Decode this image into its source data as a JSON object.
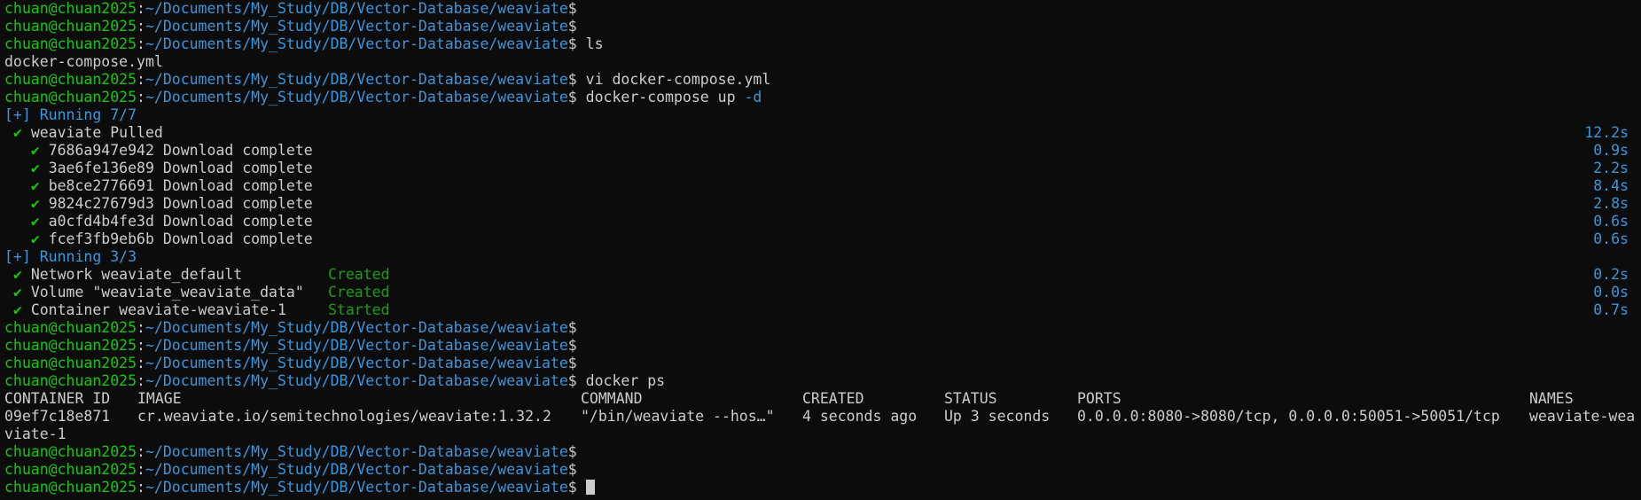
{
  "prompt": {
    "user": "chuan@chuan2025",
    "colon": ":",
    "path": "~/Documents/My_Study/DB/Vector-Database/weaviate",
    "dollar": "$"
  },
  "commands": {
    "ls": "ls",
    "ls_output": "docker-compose.yml",
    "vi": "vi docker-compose.yml",
    "compose_cmd": "docker-compose up ",
    "compose_flag": "-d",
    "ps": "docker ps"
  },
  "pull": {
    "header": "[+] Running 7/7",
    "check_glyph": "✔",
    "main": {
      "label": "weaviate Pulled",
      "time": "12.2s"
    },
    "layers": [
      {
        "id": "7686a947e942",
        "status": "Download complete",
        "time": "0.9s"
      },
      {
        "id": "3ae6fe136e89",
        "status": "Download complete",
        "time": "2.2s"
      },
      {
        "id": "be8ce2776691",
        "status": "Download complete",
        "time": "8.4s"
      },
      {
        "id": "9824c27679d3",
        "status": "Download complete",
        "time": "2.8s"
      },
      {
        "id": "a0cfd4b4fe3d",
        "status": "Download complete",
        "time": "0.6s"
      },
      {
        "id": "fcef3fb9eb6b",
        "status": "Download complete",
        "time": "0.6s"
      }
    ]
  },
  "run": {
    "header": "[+] Running 3/3",
    "items": [
      {
        "label": "Network weaviate_default",
        "state": "Created",
        "time": "0.2s"
      },
      {
        "label": "Volume \"weaviate_weaviate_data\"",
        "state": "Created",
        "time": "0.0s"
      },
      {
        "label": "Container weaviate-weaviate-1",
        "state": "Started",
        "time": "0.7s"
      }
    ]
  },
  "ps_table": {
    "headers": {
      "container_id": "CONTAINER ID",
      "image": "IMAGE",
      "command": "COMMAND",
      "created": "CREATED",
      "status": "STATUS",
      "ports": "PORTS",
      "names": "NAMES"
    },
    "row": {
      "container_id": "09ef7c18e871",
      "image": "cr.weaviate.io/semitechnologies/weaviate:1.32.2",
      "command": "\"/bin/weaviate --hos…\"",
      "created": "4 seconds ago",
      "status": "Up 3 seconds",
      "ports": "0.0.0.0:8080->8080/tcp, 0.0.0.0:50051->50051/tcp",
      "names": "weaviate-wea"
    },
    "wrap": "viate-1"
  }
}
